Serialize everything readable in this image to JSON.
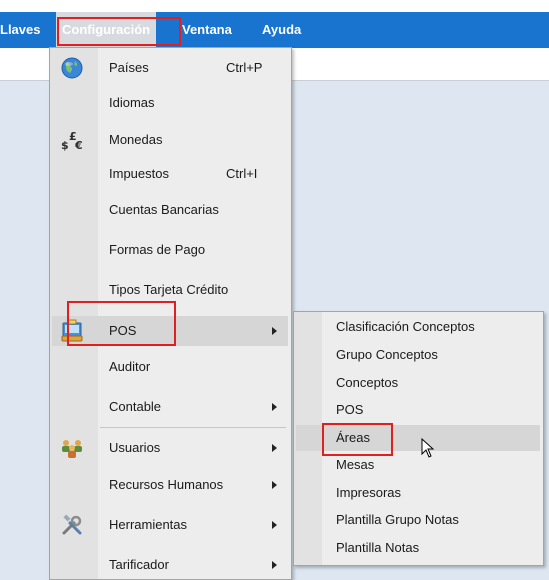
{
  "menubar": {
    "items": [
      {
        "label": "Llaves"
      },
      {
        "label": "Configuración"
      },
      {
        "label": "Ventana"
      },
      {
        "label": "Ayuda"
      }
    ]
  },
  "config_menu": {
    "items": [
      {
        "label": "Países",
        "shortcut": "Ctrl+P",
        "icon": "globe-icon"
      },
      {
        "label": "Idiomas"
      },
      {
        "label": "Monedas",
        "icon": "currency-icon"
      },
      {
        "label": "Impuestos",
        "shortcut": "Ctrl+I"
      },
      {
        "label": "Cuentas Bancarias"
      },
      {
        "label": "Formas de Pago"
      },
      {
        "label": "Tipos Tarjeta Crédito"
      },
      {
        "label": "POS",
        "submenu": true,
        "icon": "pos-icon",
        "highlighted": true
      },
      {
        "label": "Auditor"
      },
      {
        "label": "Contable",
        "submenu": true
      },
      {
        "label": "Usuarios",
        "submenu": true,
        "icon": "users-icon"
      },
      {
        "label": "Recursos Humanos",
        "submenu": true
      },
      {
        "label": "Herramientas",
        "submenu": true,
        "icon": "tools-icon"
      },
      {
        "label": "Tarificador",
        "submenu": true
      }
    ]
  },
  "pos_submenu": {
    "items": [
      {
        "label": "Clasificación Conceptos"
      },
      {
        "label": "Grupo Conceptos"
      },
      {
        "label": "Conceptos"
      },
      {
        "label": "POS"
      },
      {
        "label": "Áreas",
        "highlighted": true
      },
      {
        "label": "Mesas"
      },
      {
        "label": "Impresoras"
      },
      {
        "label": "Plantilla Grupo Notas"
      },
      {
        "label": "Plantilla Notas"
      }
    ]
  },
  "colors": {
    "menubar": "#1874cf",
    "workspace": "#dde6f1",
    "menu_bg": "#ededed",
    "highlight": "#d6d6d6",
    "annotation": "#e02020"
  }
}
